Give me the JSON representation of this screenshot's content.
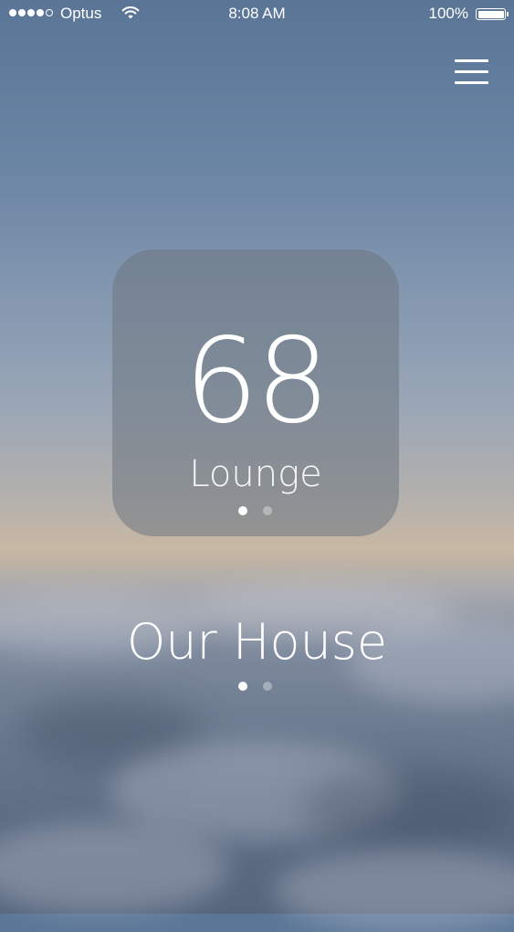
{
  "status_bar": {
    "carrier": "Optus",
    "time": "8:08 AM",
    "battery_percent": "100%",
    "signal_strength": 4,
    "signal_max": 5
  },
  "menu": {
    "icon": "hamburger-menu-icon"
  },
  "room_card": {
    "temperature": "68",
    "room_name": "Lounge",
    "page_count": 2,
    "active_page": 1
  },
  "house": {
    "title": "Our House",
    "page_count": 2,
    "active_page": 1
  },
  "colors": {
    "text": "#ffffff",
    "card_background": "rgba(110,118,128,0.55)",
    "sky_top": "#5a7596",
    "horizon": "#c9b8a3",
    "clouds": "#5d6c83"
  }
}
